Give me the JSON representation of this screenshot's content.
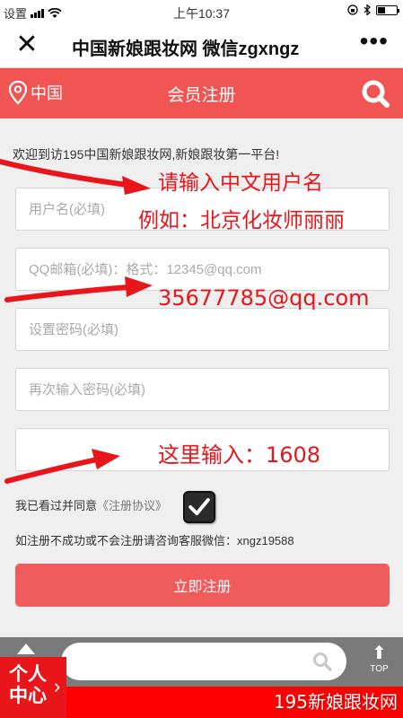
{
  "status_bar": {
    "carrier": "设置",
    "time": "上午10:37"
  },
  "wechat_nav": {
    "title": "中国新娘跟妆网 微信zgxngz"
  },
  "header": {
    "location": "中国",
    "title": "会员注册"
  },
  "form": {
    "welcome": "欢迎到访195中国新娘跟妆网,新娘跟妆第一平台!",
    "username_placeholder": "用户名(必填)",
    "email_placeholder": "QQ邮箱(必填)：格式：12345@qq.com",
    "password_placeholder": "设置密码(必填)",
    "password_confirm_placeholder": "再次输入密码(必填)",
    "captcha_placeholder": "",
    "agree_text": "我已看过并同意",
    "agreement_link": "《注册协议》",
    "agree_checked": true,
    "contact_text": "如注册不成功或不会注册请咨询客服微信：xngz19588",
    "submit_label": "立即注册"
  },
  "annotations": {
    "line1": "请输入中文用户名",
    "line2": "例如：北京化妆师丽丽",
    "line3": "35677785@qq.com",
    "line4": "这里输入：1608"
  },
  "bottom": {
    "member_label": "个人中心",
    "top_label": "TOP",
    "watermark": "195新娘跟妆网"
  },
  "colors": {
    "brand_red": "#f05453",
    "annotation_red": "#e8151b"
  }
}
